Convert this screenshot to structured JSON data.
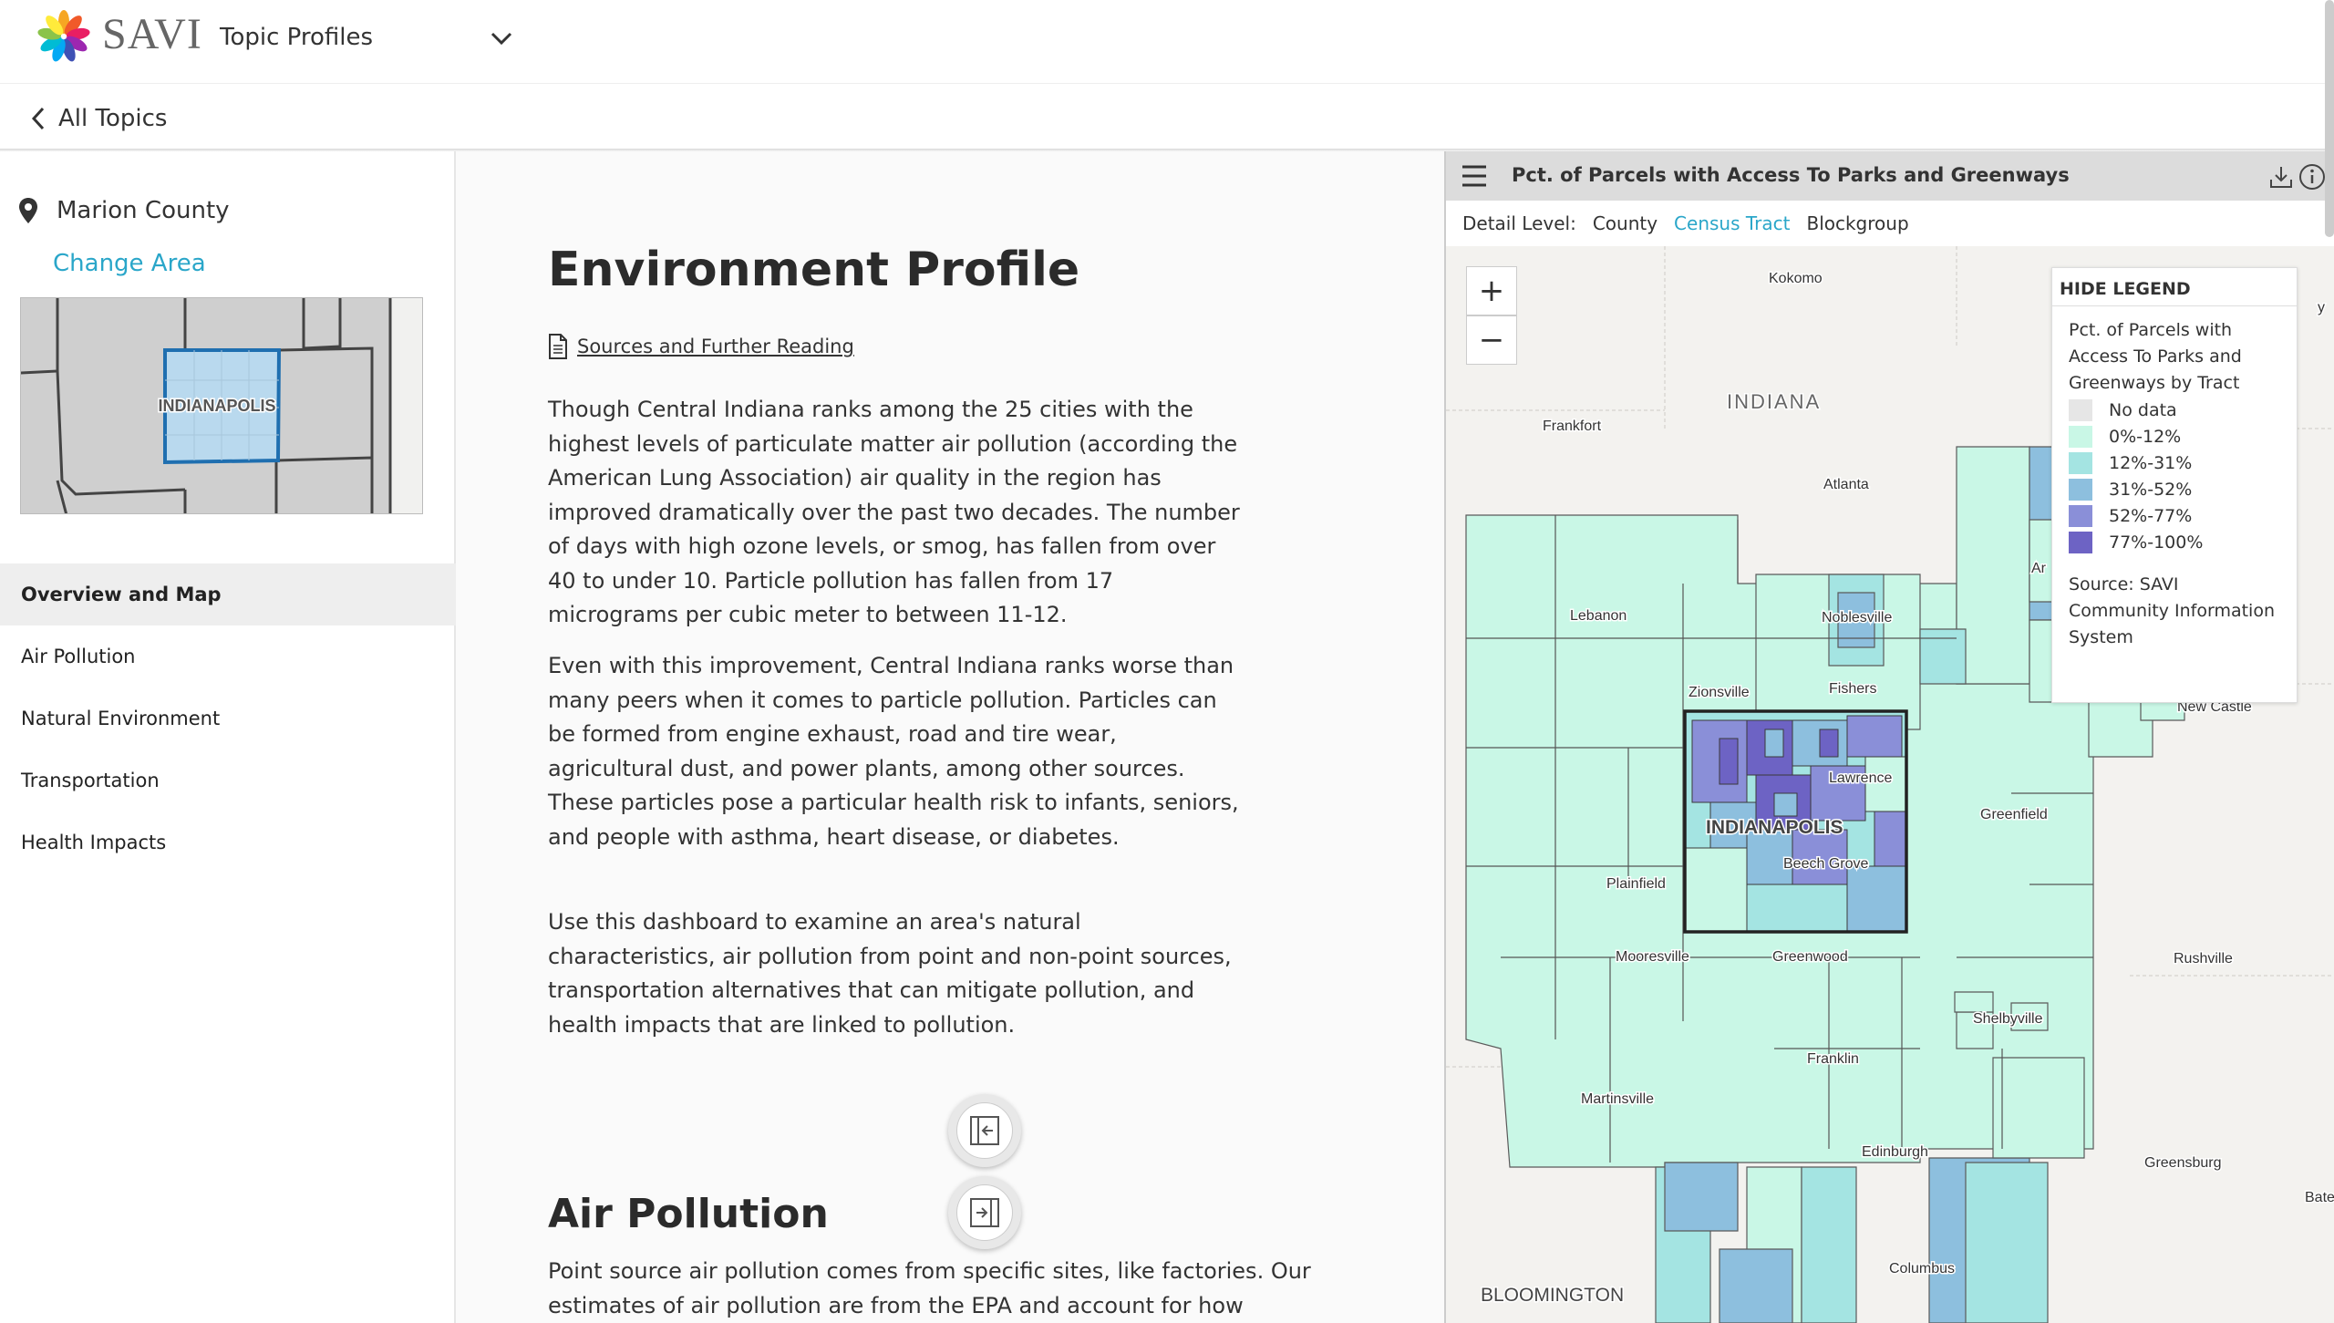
{
  "header": {
    "brand": "SAVI",
    "section": "Topic Profiles"
  },
  "nav_back": {
    "label": "All Topics"
  },
  "sidebar": {
    "area_name": "Marion County",
    "change_area": "Change Area",
    "thumbnail_label": "INDIANAPOLIS",
    "items": [
      {
        "label": "Overview and Map",
        "active": true
      },
      {
        "label": "Air Pollution",
        "active": false
      },
      {
        "label": "Natural Environment",
        "active": false
      },
      {
        "label": "Transportation",
        "active": false
      },
      {
        "label": "Health Impacts",
        "active": false
      }
    ]
  },
  "main": {
    "title": "Environment Profile",
    "sources_link": "Sources and Further Reading",
    "paragraphs": [
      "Though Central Indiana ranks among the 25 cities with the highest levels of particulate matter air pollution (according the American Lung Association) air quality in the region has improved dramatically over the past two decades. The number of days with high ozone levels, or smog, has fallen from over 40 to under 10. Particle pollution has fallen from 17 micrograms per cubic meter to between 11-12.",
      "Even with this improvement, Central Indiana ranks worse than many peers when it comes to particle pollution. Particles can be formed from engine exhaust, road and tire wear, agricultural dust, and power plants, among other sources. These particles pose a particular health risk to infants, seniors, and people with asthma, heart disease, or diabetes.",
      "Use this dashboard to examine an area's natural characteristics, air pollution from point and non-point sources, transportation alternatives that can mitigate pollution, and health impacts that are linked to pollution."
    ],
    "section_title": "Air Pollution",
    "section_text": "Point source air pollution comes from specific sites, like factories. Our estimates of air pollution are from the EPA and account for how"
  },
  "map": {
    "title": "Pct. of Parcels with Access To Parks and Greenways",
    "detail_label": "Detail Level:",
    "detail_levels": {
      "county": "County",
      "tract": "Census Tract",
      "blockgroup": "Blockgroup"
    },
    "selected_detail": "Census Tract",
    "zoom_in": "+",
    "zoom_out": "−",
    "place_labels": {
      "kokomo": "Kokomo",
      "indiana": "INDIANA",
      "frankfort": "Frankfort",
      "atlanta": "Atlanta",
      "lebanon": "Lebanon",
      "noblesville": "Noblesville",
      "zionsville": "Zionsville",
      "fishers": "Fishers",
      "lawrence": "Lawrence",
      "indianapolis": "INDIANAPOLIS",
      "beech_grove": "Beech Grove",
      "greenfield": "Greenfield",
      "plainfield": "Plainfield",
      "mooresville": "Mooresville",
      "greenwood": "Greenwood",
      "rushville": "Rushville",
      "shelbyville": "Shelbyville",
      "franklin": "Franklin",
      "martinsville": "Martinsville",
      "edinburgh": "Edinburgh",
      "greensburg": "Greensburg",
      "columbus": "Columbus",
      "bloomington": "BLOOMINGTON",
      "new_castle": "New Castle",
      "bate": "Bate",
      "ar": "Ar",
      "y": "y"
    },
    "legend": {
      "hide_label": "HIDE LEGEND",
      "title": "Pct. of Parcels with Access To Parks and Greenways by Tract",
      "items": [
        {
          "label": "No data",
          "color": "#e6e6e6"
        },
        {
          "label": "0%-12%",
          "color": "#c9f7e6"
        },
        {
          "label": "12%-31%",
          "color": "#a4e4e2"
        },
        {
          "label": "31%-52%",
          "color": "#8dbfde"
        },
        {
          "label": "52%-77%",
          "color": "#8a8fd8"
        },
        {
          "label": "77%-100%",
          "color": "#6d63c4"
        }
      ],
      "source": "Source: SAVI Community Information System"
    }
  }
}
